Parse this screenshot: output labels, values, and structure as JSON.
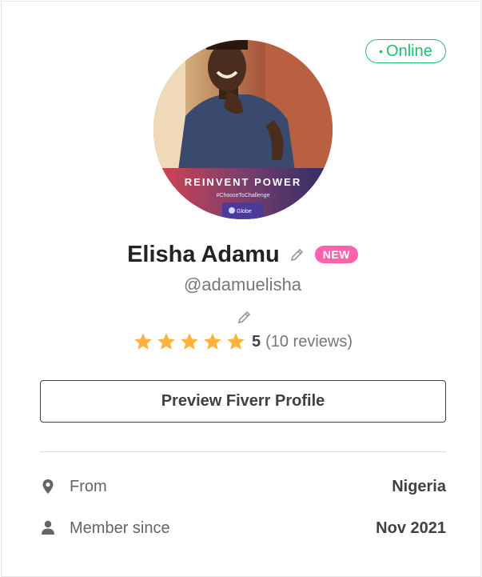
{
  "status": {
    "dot": "•",
    "label": "Online"
  },
  "avatar": {
    "banner_text": "REINVENT POWER",
    "hashtag": "#ChooseToChallenge",
    "logo_text": "Globe"
  },
  "profile": {
    "name": "Elisha Adamu",
    "badge": "NEW",
    "username": "@adamuelisha"
  },
  "rating": {
    "stars": 5,
    "score": "5",
    "reviews": "(10 reviews)"
  },
  "preview_button": {
    "label": "Preview Fiverr Profile"
  },
  "info": {
    "from_label": "From",
    "from_value": "Nigeria",
    "member_label": "Member since",
    "member_value": "Nov 2021"
  },
  "colors": {
    "online": "#1dbf73",
    "badge": "#ff62ad",
    "star": "#ffb33e",
    "text": "#404145"
  }
}
